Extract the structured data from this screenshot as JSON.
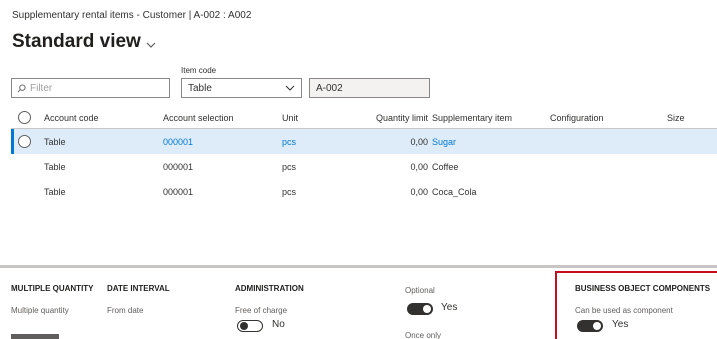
{
  "breadcrumb": "Supplementary rental items - Customer  |  A-002 : A002",
  "title": "Standard view",
  "filter": {
    "placeholder": "Filter"
  },
  "item_code": {
    "label": "Item code",
    "value": "Table",
    "readonly_value": "A-002"
  },
  "grid": {
    "headers": {
      "account_code": "Account code",
      "account_selection": "Account selection",
      "unit": "Unit",
      "quantity_limit": "Quantity limit",
      "supplementary_item": "Supplementary item",
      "configuration": "Configuration",
      "size": "Size"
    },
    "rows": [
      {
        "account_code": "Table",
        "account_selection": "000001",
        "unit": "pcs",
        "quantity_limit": "0,00",
        "supplementary_item": "Sugar",
        "selected": true
      },
      {
        "account_code": "Table",
        "account_selection": "000001",
        "unit": "pcs",
        "quantity_limit": "0,00",
        "supplementary_item": "Coffee",
        "selected": false
      },
      {
        "account_code": "Table",
        "account_selection": "000001",
        "unit": "pcs",
        "quantity_limit": "0,00",
        "supplementary_item": "Coca_Cola",
        "selected": false
      }
    ]
  },
  "details": {
    "multiple_quantity": {
      "title": "MULTIPLE QUANTITY",
      "field": "Multiple quantity"
    },
    "date_interval": {
      "title": "DATE INTERVAL",
      "field": "From date"
    },
    "administration": {
      "title": "ADMINISTRATION",
      "field": "Free of charge",
      "toggle_label": "No"
    },
    "optional": {
      "field": "Optional",
      "toggle_label": "Yes",
      "next_field": "Once only"
    },
    "business_object": {
      "title": "BUSINESS OBJECT COMPONENTS",
      "field": "Can be used as component",
      "toggle_label": "Yes"
    }
  },
  "colors": {
    "accent": "#0078d4",
    "selected_row": "#deecf9",
    "highlight": "#c50f1f"
  }
}
